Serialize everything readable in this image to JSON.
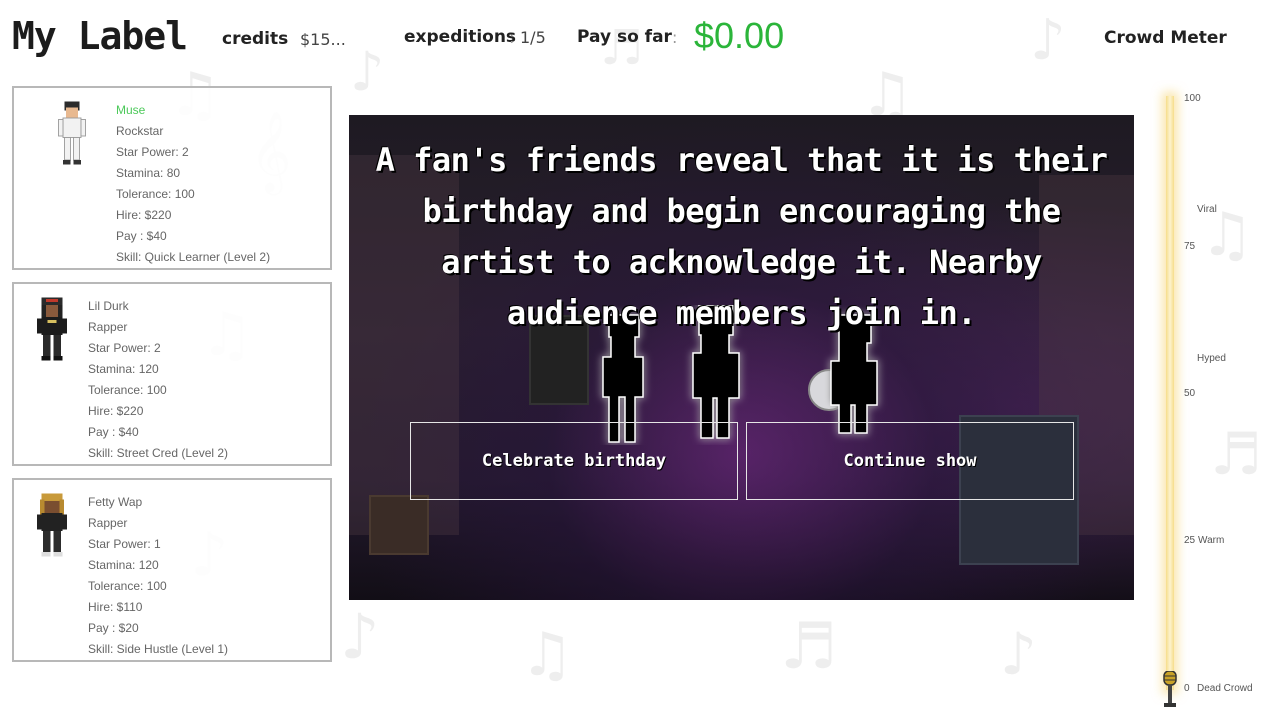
{
  "header": {
    "logo": "My Label",
    "credits_label": "credits",
    "credits_value": "$15...",
    "expeditions_label": "expeditions",
    "expeditions_value": "1/5",
    "pay_label": "Pay so far",
    "pay_value": "$0.00",
    "meter_title": "Crowd Meter"
  },
  "roster": [
    {
      "name": "Muse",
      "type": "Rockstar",
      "star_power": "Star Power: 2",
      "stamina": "Stamina: 80",
      "tolerance": "Tolerance: 100",
      "hire": "Hire: $220",
      "pay": "Pay : $40",
      "skill": "Skill: Quick Learner (Level 2)"
    },
    {
      "name": "Lil Durk",
      "type": "Rapper",
      "star_power": "Star Power: 2",
      "stamina": "Stamina: 120",
      "tolerance": "Tolerance: 100",
      "hire": "Hire: $220",
      "pay": "Pay : $40",
      "skill": "Skill: Street Cred (Level 2)"
    },
    {
      "name": "Fetty Wap",
      "type": "Rapper",
      "star_power": "Star Power: 1",
      "stamina": "Stamina: 120",
      "tolerance": "Tolerance: 100",
      "hire": "Hire: $110",
      "pay": "Pay : $20",
      "skill": "Skill: Side Hustle (Level 1)"
    }
  ],
  "event": {
    "text": "A fan's friends reveal that it is their birthday and begin encouraging the artist to acknowledge it. Nearby audience members join in.",
    "choices": [
      "Celebrate birthday",
      "Continue show"
    ]
  },
  "crowd_meter": {
    "value": 0,
    "ticks": [
      {
        "value": "100",
        "label": ""
      },
      {
        "value": "",
        "label": "Viral"
      },
      {
        "value": "75",
        "label": ""
      },
      {
        "value": "",
        "label": "Hyped"
      },
      {
        "value": "50",
        "label": ""
      },
      {
        "value": "25",
        "label": "Warm"
      },
      {
        "value": "0",
        "label": "Dead Crowd"
      }
    ]
  },
  "colors": {
    "pay_green": "#2bb53a",
    "selected_name_green": "#4cc95a",
    "meter_gold": "#f6dd8a"
  }
}
